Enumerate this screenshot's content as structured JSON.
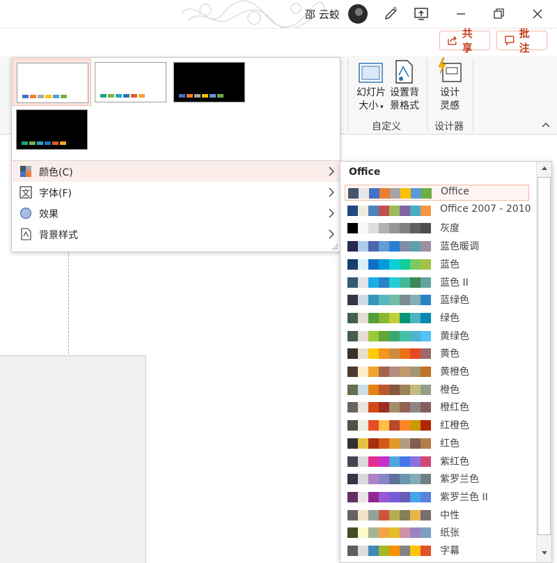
{
  "titlebar": {
    "user_name": "邵 云蛟"
  },
  "ribbon": {
    "share_label": "共享",
    "comment_label": "批注",
    "slide_size_label": "幻灯片",
    "slide_size_label2": "大小",
    "format_bg_label": "设置背",
    "format_bg_label2": "景格式",
    "design_ideas_label": "设计",
    "design_ideas_label2": "灵感",
    "group_customize": "自定义",
    "group_designer": "设计器",
    "accent_color": "#c43e1c"
  },
  "gallery": {
    "variants": [
      {
        "background": "#ffffff",
        "bars": [
          "#4472c4",
          "#ed7d31",
          "#a5a5a5",
          "#ffc000",
          "#5b9bd5",
          "#70ad47"
        ]
      },
      {
        "background": "#ffffff",
        "bars": [
          "#1ca086",
          "#7cb342",
          "#26a5c6",
          "#1e73be",
          "#e35926",
          "#f2a531"
        ]
      },
      {
        "background": "#000000",
        "bars": [
          "#4472c4",
          "#ed7d31",
          "#a5a5a5",
          "#ffc000",
          "#5b9bd5",
          "#70ad47"
        ]
      },
      {
        "background": "#000000",
        "bars": [
          "#1ca086",
          "#7cb342",
          "#26a5c6",
          "#1e73be",
          "#e35926",
          "#f2a531"
        ]
      }
    ],
    "menu": [
      {
        "label": "颜色(C)",
        "icon": "color-palette-icon"
      },
      {
        "label": "字体(F)",
        "icon": "font-icon"
      },
      {
        "label": "效果",
        "icon": "effects-icon"
      },
      {
        "label": "背景样式",
        "icon": "background-style-icon"
      }
    ]
  },
  "colors_panel": {
    "header": "Office",
    "schemes": [
      {
        "name": "Office",
        "colors": [
          "#44546a",
          "#e7e6e6",
          "#4472c4",
          "#ed7d31",
          "#a5a5a5",
          "#ffc000",
          "#5b9bd5",
          "#70ad47"
        ]
      },
      {
        "name": "Office 2007 - 2010",
        "colors": [
          "#1f497d",
          "#eeece1",
          "#4f81bd",
          "#c0504d",
          "#9bbb59",
          "#8064a2",
          "#4bacc6",
          "#f79646"
        ]
      },
      {
        "name": "灰度",
        "colors": [
          "#000000",
          "#f8f8f8",
          "#dddddd",
          "#b2b2b2",
          "#969696",
          "#808080",
          "#5f5f5f",
          "#4d4d4d"
        ]
      },
      {
        "name": "蓝色暖调",
        "colors": [
          "#242852",
          "#acccea",
          "#4a66ac",
          "#629dd1",
          "#297fd5",
          "#7f8fa9",
          "#5aa2ae",
          "#9d90a0"
        ]
      },
      {
        "name": "蓝色",
        "colors": [
          "#17406d",
          "#dbeff9",
          "#0f6fc6",
          "#009dd9",
          "#0bd0d9",
          "#10cf9b",
          "#7cca62",
          "#a5c249"
        ]
      },
      {
        "name": "蓝色 II",
        "colors": [
          "#335b74",
          "#dfe3e5",
          "#1cade4",
          "#2683c6",
          "#27ced7",
          "#42ba97",
          "#3e8853",
          "#62a39f"
        ]
      },
      {
        "name": "蓝绿色",
        "colors": [
          "#373545",
          "#cedbe6",
          "#3494ba",
          "#58b6c0",
          "#75bda7",
          "#7a8c8e",
          "#84acb6",
          "#2683c6"
        ]
      },
      {
        "name": "绿色",
        "colors": [
          "#455f51",
          "#e3ded1",
          "#549e39",
          "#8ab833",
          "#c0cf3a",
          "#029676",
          "#4ab5c4",
          "#0989b1"
        ]
      },
      {
        "name": "黄绿色",
        "colors": [
          "#455f51",
          "#e3ded1",
          "#99cb38",
          "#63a537",
          "#37a76f",
          "#44c1a3",
          "#4eb3cf",
          "#51c3f9"
        ]
      },
      {
        "name": "黄色",
        "colors": [
          "#39302a",
          "#e5dec9",
          "#ffca08",
          "#f8931d",
          "#ce8d3e",
          "#ec7016",
          "#e64823",
          "#9c6a6a"
        ]
      },
      {
        "name": "黄橙色",
        "colors": [
          "#4e3b30",
          "#fbeec9",
          "#f0a22e",
          "#a5644e",
          "#b58b80",
          "#c3986d",
          "#a19574",
          "#c17529"
        ]
      },
      {
        "name": "橙色",
        "colors": [
          "#637052",
          "#ccddea",
          "#e48312",
          "#bd582c",
          "#865640",
          "#9b8357",
          "#c2bc80",
          "#94a088"
        ]
      },
      {
        "name": "橙红色",
        "colors": [
          "#696464",
          "#e9e5dc",
          "#d34817",
          "#9b2d1f",
          "#a28e6a",
          "#956251",
          "#918485",
          "#855d5d"
        ]
      },
      {
        "name": "红橙色",
        "colors": [
          "#505046",
          "#eeece1",
          "#e84c22",
          "#ffbd47",
          "#b64926",
          "#ff8427",
          "#cc9900",
          "#b22600"
        ]
      },
      {
        "name": "红色",
        "colors": [
          "#323232",
          "#e5c243",
          "#a5300f",
          "#d55816",
          "#e19825",
          "#b19c7d",
          "#7f5f52",
          "#b27d49"
        ]
      },
      {
        "name": "紫红色",
        "colors": [
          "#454551",
          "#d8d9dc",
          "#e32d91",
          "#c830cc",
          "#4ea6dc",
          "#4775e7",
          "#8971e1",
          "#d54773"
        ]
      },
      {
        "name": "紫罗兰色",
        "colors": [
          "#373545",
          "#dcd8dc",
          "#ad84c6",
          "#8784c7",
          "#5d739a",
          "#6997af",
          "#84acb6",
          "#6f8183"
        ]
      },
      {
        "name": "紫罗兰色 II",
        "colors": [
          "#632e62",
          "#eae5eb",
          "#92278f",
          "#9b57d3",
          "#755dd9",
          "#665eb8",
          "#45a5ed",
          "#5982db"
        ]
      },
      {
        "name": "中性",
        "colors": [
          "#696464",
          "#f2e3c6",
          "#93a299",
          "#cf543f",
          "#b5ae53",
          "#848058",
          "#e8b54d",
          "#786c71"
        ]
      },
      {
        "name": "纸张",
        "colors": [
          "#444d26",
          "#fefac9",
          "#a5b592",
          "#f3a447",
          "#e7bc29",
          "#d092a7",
          "#9c85c0",
          "#809ec2"
        ]
      },
      {
        "name": "字幕",
        "colors": [
          "#5e5e5e",
          "#dddddd",
          "#418ab3",
          "#a6b727",
          "#f69200",
          "#838383",
          "#fec306",
          "#df5327"
        ]
      }
    ]
  }
}
